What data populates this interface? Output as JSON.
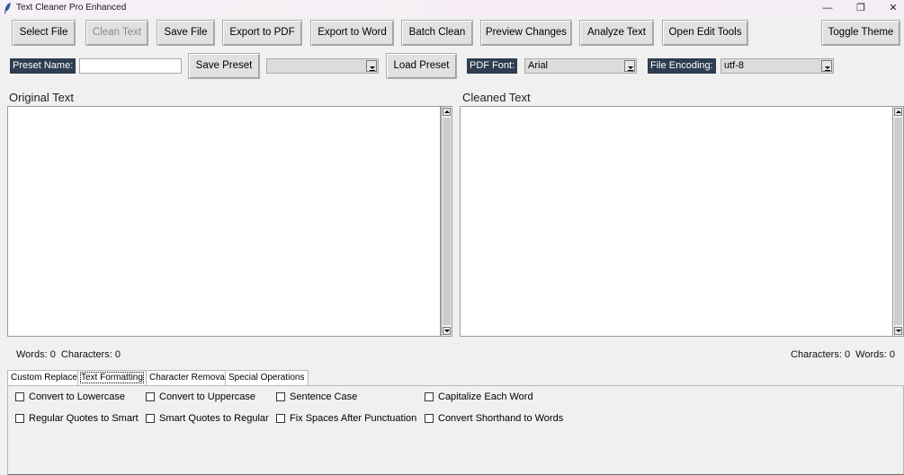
{
  "window": {
    "title": "Text Cleaner Pro Enhanced",
    "controls": {
      "minimize": "—",
      "restore": "❐",
      "close": "✕"
    }
  },
  "toolbar": {
    "buttons": [
      {
        "label": "Select File",
        "enabled": true
      },
      {
        "label": "Clean Text",
        "enabled": false
      },
      {
        "label": "Save File",
        "enabled": true
      },
      {
        "label": "Export to PDF",
        "enabled": true
      },
      {
        "label": "Export to Word",
        "enabled": true
      },
      {
        "label": "Batch Clean",
        "enabled": true
      },
      {
        "label": "Preview Changes",
        "enabled": true
      },
      {
        "label": "Analyze Text",
        "enabled": true
      },
      {
        "label": "Open Edit Tools",
        "enabled": true
      }
    ],
    "toggle_theme": "Toggle Theme"
  },
  "preset_row": {
    "preset_name_label": "Preset Name:",
    "preset_name_value": "",
    "save_preset": "Save Preset",
    "preset_select_value": "",
    "load_preset": "Load Preset",
    "pdf_font_label": "PDF Font:",
    "pdf_font_value": "Arial",
    "file_encoding_label": "File Encoding:",
    "file_encoding_value": "utf-8"
  },
  "original": {
    "label": "Original Text",
    "content": "",
    "stats": "Words: 0  Characters: 0"
  },
  "cleaned": {
    "label": "Cleaned Text",
    "content": "",
    "stats": "Characters: 0  Words: 0"
  },
  "tabs": [
    {
      "label": "Custom Replace",
      "active": false
    },
    {
      "label": "Text Formatting",
      "active": true
    },
    {
      "label": "Character Removal",
      "active": false
    },
    {
      "label": "Special Operations",
      "active": false
    }
  ],
  "formatting_options": [
    {
      "label": "Convert to Lowercase",
      "checked": false
    },
    {
      "label": "Convert to Uppercase",
      "checked": false
    },
    {
      "label": "Sentence Case",
      "checked": false
    },
    {
      "label": "Capitalize Each Word",
      "checked": false
    },
    {
      "label": "Regular Quotes to Smart",
      "checked": false
    },
    {
      "label": "Smart Quotes to Regular",
      "checked": false
    },
    {
      "label": "Fix Spaces After Punctuation",
      "checked": false
    },
    {
      "label": "Convert Shorthand to Words",
      "checked": false
    }
  ],
  "colors": {
    "window_bg": "#f0f0f0",
    "label_bg": "#2e3d4f",
    "label_fg": "#ffffff",
    "disabled_fg": "#8a8a8a"
  },
  "icons": {
    "app": "feather-icon",
    "dropdown": "chevron-down-icon",
    "scroll_up": "arrow-up-icon",
    "scroll_down": "arrow-down-icon"
  }
}
